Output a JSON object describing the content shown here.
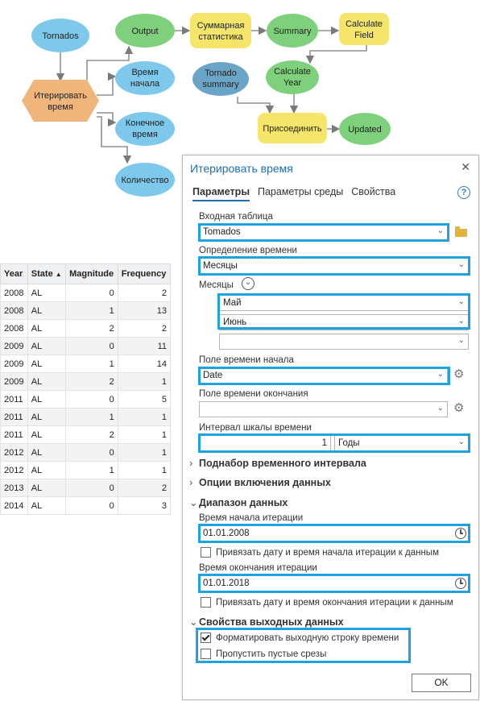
{
  "diagram": {
    "nodes": {
      "tornados": "Tornados",
      "iterate_time": [
        "Итерировать",
        "время"
      ],
      "output": "Output",
      "summary_stats": [
        "Суммарная",
        "статистика"
      ],
      "summary": "Summary",
      "calculate_field": [
        "Calculate",
        "Field"
      ],
      "start_time": [
        "Время",
        "начала"
      ],
      "end_time": [
        "Конечное",
        "время"
      ],
      "count": "Количество",
      "tornado_summary": [
        "Tornado",
        "summary"
      ],
      "calculate_year": [
        "Calculate",
        "Year"
      ],
      "join": "Присоединить",
      "updated": "Updated"
    },
    "colors": {
      "data_blue": "#7ec8ec",
      "data_blue_dark": "#6aa5c7",
      "output_green": "#7ed07c",
      "tool_yellow": "#f5e56b",
      "iterator_orange": "#f0b57b",
      "connector": "#7a7a7a"
    }
  },
  "table": {
    "headers": [
      "Year",
      "State",
      "Magnitude",
      "Frequency"
    ],
    "sort_column": "State",
    "rows": [
      [
        "2008",
        "AL",
        "0",
        "2"
      ],
      [
        "2008",
        "AL",
        "1",
        "13"
      ],
      [
        "2008",
        "AL",
        "2",
        "2"
      ],
      [
        "2009",
        "AL",
        "0",
        "11"
      ],
      [
        "2009",
        "AL",
        "1",
        "14"
      ],
      [
        "2009",
        "AL",
        "2",
        "1"
      ],
      [
        "2011",
        "AL",
        "0",
        "5"
      ],
      [
        "2011",
        "AL",
        "1",
        "1"
      ],
      [
        "2011",
        "AL",
        "2",
        "1"
      ],
      [
        "2012",
        "AL",
        "0",
        "1"
      ],
      [
        "2012",
        "AL",
        "1",
        "1"
      ],
      [
        "2013",
        "AL",
        "0",
        "2"
      ],
      [
        "2014",
        "AL",
        "0",
        "3"
      ]
    ]
  },
  "dialog": {
    "title": "Итерировать время",
    "close_icon": "close-icon",
    "tabs": [
      "Параметры",
      "Параметры среды",
      "Свойства"
    ],
    "active_tab": "Параметры",
    "help_glyph": "?",
    "input_table": {
      "label": "Входная таблица",
      "value": "Tomados"
    },
    "time_definition": {
      "label": "Определение времени",
      "value": "Месяцы"
    },
    "months": {
      "label": "Месяцы",
      "values": [
        "Май",
        "Июнь",
        ""
      ]
    },
    "start_time_field": {
      "label": "Поле времени начала",
      "value": "Date"
    },
    "end_time_field": {
      "label": "Поле времени окончания",
      "value": ""
    },
    "time_step": {
      "label": "Интервал шкалы времени",
      "value": "1",
      "unit": "Годы"
    },
    "sections": {
      "subset": "Поднабор временного интервала",
      "include": "Опции включения данных",
      "range": "Диапазон данных",
      "output": "Свойства выходных данных"
    },
    "iter_start": {
      "label": "Время начала итерации",
      "value": "01.01.2008",
      "snap_label": "Привязать дату и время начала итерации к данным",
      "snap_checked": false
    },
    "iter_end": {
      "label": "Время окончания итерации",
      "value": "01.01.2018",
      "snap_label": "Привязать дату и время окончания итерации к данным",
      "snap_checked": false
    },
    "format_output": {
      "label": "Форматировать выходную строку времени",
      "checked": true
    },
    "skip_empty": {
      "label": "Пропустить пустые срезы",
      "checked": false
    },
    "ok_label": "OK",
    "highlight_color": "#1fa2e0"
  }
}
